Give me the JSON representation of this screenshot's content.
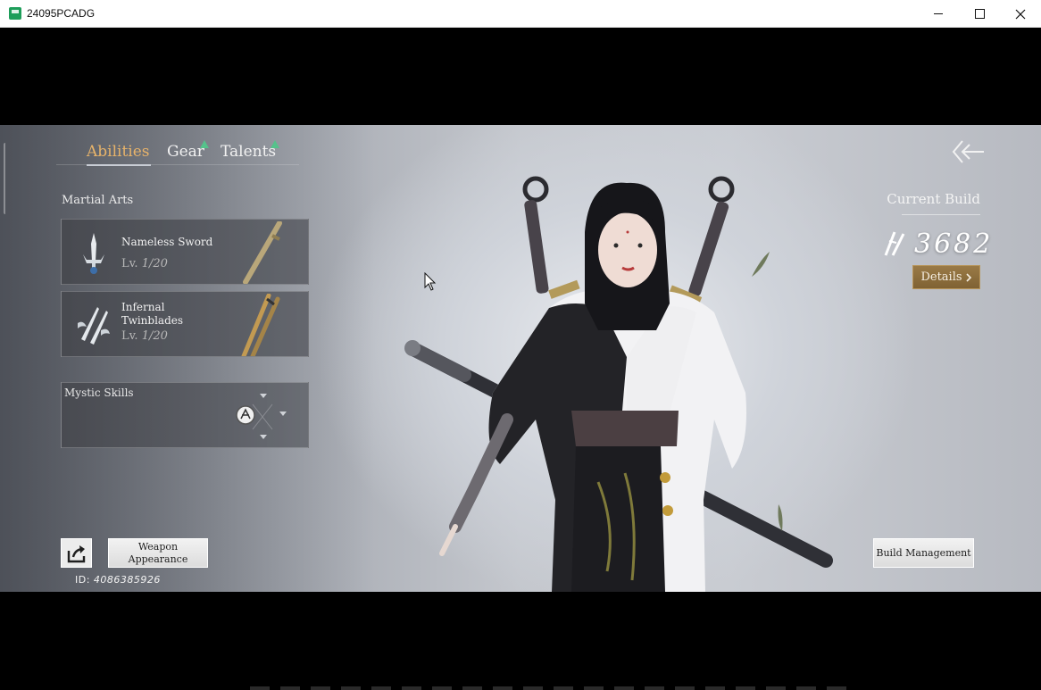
{
  "window": {
    "title": "24095PCADG",
    "minimize": "minimize",
    "maximize": "maximize",
    "close": "close"
  },
  "tabs": [
    {
      "label": "Abilities",
      "active": true,
      "badge": false
    },
    {
      "label": "Gear",
      "active": false,
      "badge": true
    },
    {
      "label": "Talents",
      "active": false,
      "badge": true
    }
  ],
  "martial_arts": {
    "label": "Martial Arts",
    "items": [
      {
        "name": "Nameless Sword",
        "level_prefix": "Lv.",
        "level": "1/20"
      },
      {
        "name_line1": "Infernal",
        "name_line2": "Twinblades",
        "level_prefix": "Lv.",
        "level": "1/20"
      }
    ]
  },
  "mystic_skills": {
    "label": "Mystic Skills"
  },
  "build": {
    "label": "Current Build",
    "score": "3682",
    "details_label": "Details"
  },
  "bottom": {
    "weapon_appearance_line1": "Weapon",
    "weapon_appearance_line2": "Appearance",
    "id_prefix": "ID:",
    "id_value": "4086385926",
    "build_management": "Build Management"
  },
  "colors": {
    "active_tab": "#e7b36a",
    "badge": "#55c28b",
    "details_button": "#8a6b3a"
  }
}
